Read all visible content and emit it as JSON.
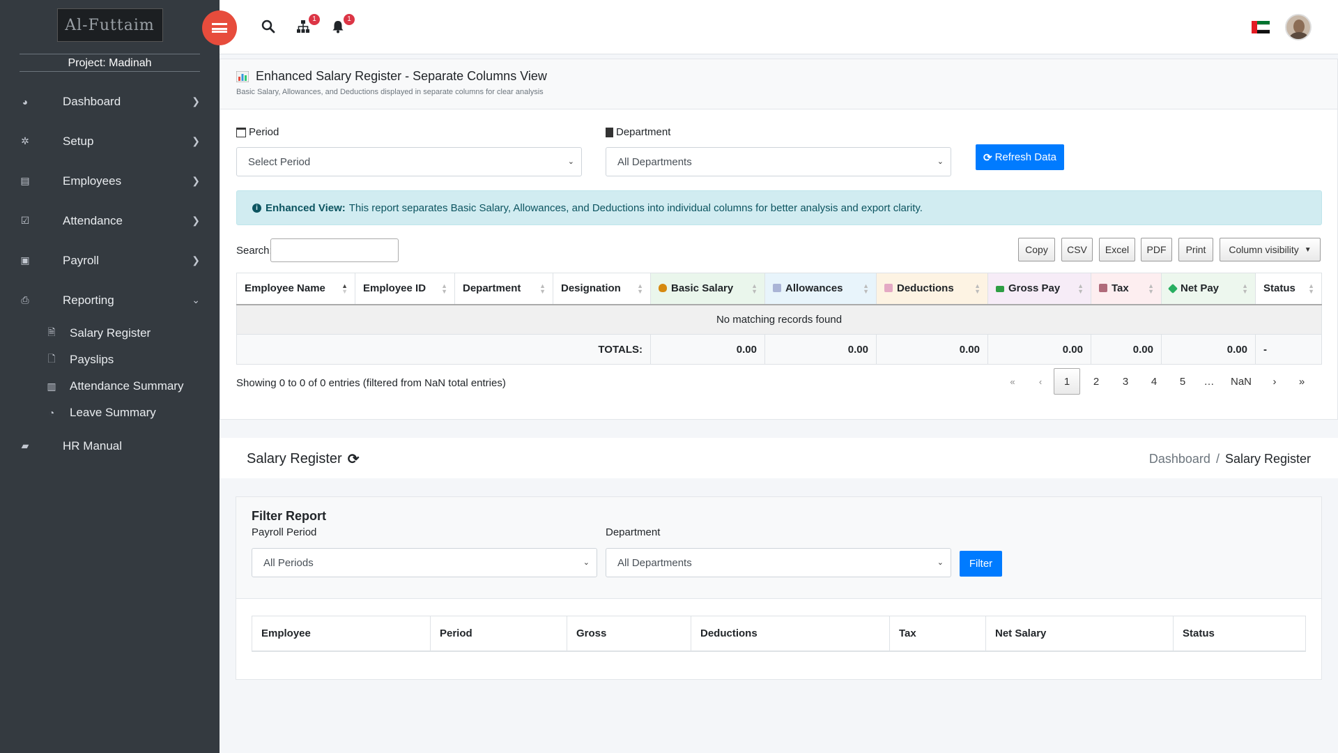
{
  "sidebar": {
    "logo_text": "Al-Futtaim",
    "project": "Project: Madinah",
    "items": [
      {
        "label": "Dashboard"
      },
      {
        "label": "Setup"
      },
      {
        "label": "Employees"
      },
      {
        "label": "Attendance"
      },
      {
        "label": "Payroll"
      },
      {
        "label": "Reporting"
      },
      {
        "label": "HR Manual"
      }
    ],
    "reporting_sub": [
      {
        "label": "Salary Register"
      },
      {
        "label": "Payslips"
      },
      {
        "label": "Attendance Summary"
      },
      {
        "label": "Leave Summary"
      }
    ]
  },
  "topbar": {
    "org_badge": "1",
    "bell_badge": "1"
  },
  "report": {
    "title": "Enhanced Salary Register - Separate Columns View",
    "subtitle": "Basic Salary, Allowances, and Deductions displayed in separate columns for clear analysis",
    "period_label": "Period",
    "period_value": "Select Period",
    "department_label": "Department",
    "department_value": "All Departments",
    "refresh_label": "Refresh Data",
    "alert_bold": "Enhanced View:",
    "alert_text": "This report separates Basic Salary, Allowances, and Deductions into individual columns for better analysis and export clarity.",
    "search_label": "Search:",
    "buttons": [
      "Copy",
      "CSV",
      "Excel",
      "PDF",
      "Print",
      "Column visibility"
    ],
    "columns": [
      "Employee Name",
      "Employee ID",
      "Department",
      "Designation",
      "Basic Salary",
      "Allowances",
      "Deductions",
      "Gross Pay",
      "Tax",
      "Net Pay",
      "Status"
    ],
    "no_records": "No matching records found",
    "totals_label": "TOTALS:",
    "totals": [
      "0.00",
      "0.00",
      "0.00",
      "0.00",
      "0.00",
      "0.00"
    ],
    "status_total": "-",
    "showing": "Showing 0 to 0 of 0 entries (filtered from NaN total entries)",
    "pager": [
      "«",
      "‹",
      "1",
      "2",
      "3",
      "4",
      "5",
      "…",
      "NaN",
      "›",
      "»"
    ]
  },
  "page_header": {
    "title": "Salary Register",
    "crumb_home": "Dashboard",
    "crumb_sep": "/",
    "crumb_current": "Salary Register"
  },
  "filter": {
    "title": "Filter Report",
    "period_label": "Payroll Period",
    "period_value": "All Periods",
    "department_label": "Department",
    "department_value": "All Departments",
    "button": "Filter",
    "columns": [
      "Employee",
      "Period",
      "Gross",
      "Deductions",
      "Tax",
      "Net Salary",
      "Status"
    ]
  },
  "colors": {
    "sidebar_bg": "#343a40",
    "primary": "#007bff",
    "hamburger": "#e74c3c",
    "alert_bg": "#d1ecf1",
    "basic_salary_bg": "#eaf6ec",
    "allowances_bg": "#e8f4fb",
    "deductions_bg": "#fdf3e3",
    "gross_pay_bg": "#f6ecf7",
    "tax_bg": "#fdeef0",
    "net_pay_bg": "#edf7ee"
  }
}
